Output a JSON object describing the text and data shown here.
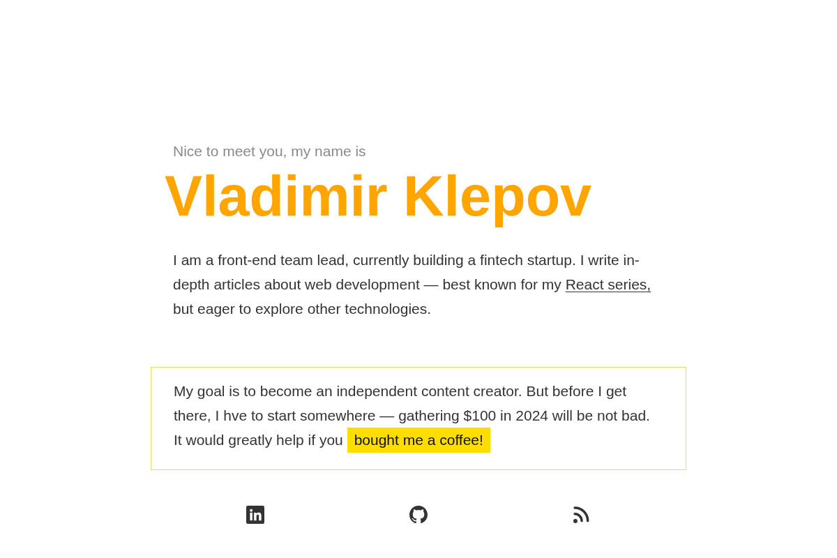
{
  "intro": "Nice to meet you, my name is",
  "name": "Vladimir Klepov",
  "bio": {
    "text_before": "I am a front-end team lead, currently building a fintech startup. I write in-depth articles about web development — best known for my ",
    "link": "React series,",
    "text_after": " but eager to explore other technologies."
  },
  "goal": {
    "text": "My goal is to become an independent content creator. But before I get there, I hve to start somewhere — gathering $100 in 2024 will be not bad. It would greatly help if you",
    "link": "bought me a coffee!"
  },
  "social_links": [
    {
      "kind": "linkedin"
    },
    {
      "kind": "github"
    },
    {
      "kind": "rss"
    }
  ]
}
